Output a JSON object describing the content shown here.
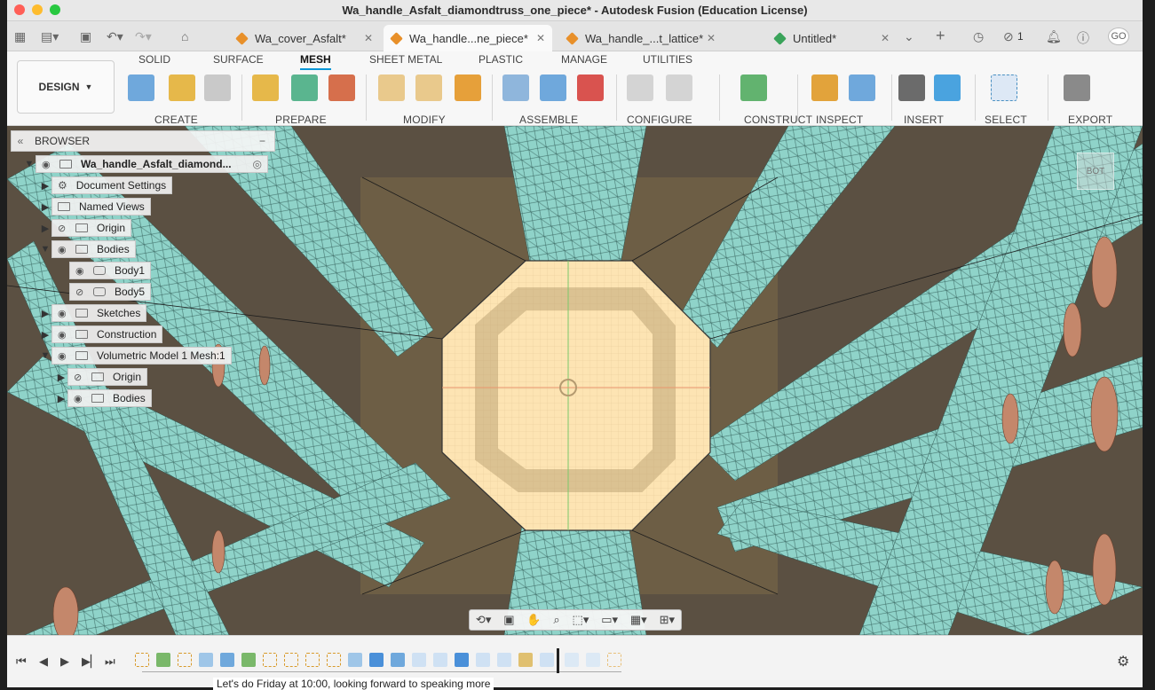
{
  "window": {
    "title": "Wa_handle_Asfalt_diamondtruss_one_piece* - Autodesk Fusion (Education License)"
  },
  "tabs": [
    {
      "label": "Wa_cover_Asfalt*"
    },
    {
      "label": "Wa_handle...ne_piece*"
    },
    {
      "label": "Wa_handle_...t_lattice*"
    },
    {
      "label": "Untitled*"
    }
  ],
  "tabbar": {
    "notification_count": "1",
    "user_initials": "GO"
  },
  "workspace": {
    "label": "DESIGN"
  },
  "toolbar_tabs": [
    {
      "label": "SOLID"
    },
    {
      "label": "SURFACE"
    },
    {
      "label": "MESH"
    },
    {
      "label": "SHEET METAL"
    },
    {
      "label": "PLASTIC"
    },
    {
      "label": "MANAGE"
    },
    {
      "label": "UTILITIES"
    }
  ],
  "tool_groups": [
    {
      "label": "CREATE"
    },
    {
      "label": "PREPARE"
    },
    {
      "label": "MODIFY"
    },
    {
      "label": "ASSEMBLE"
    },
    {
      "label": "CONFIGURE"
    },
    {
      "label": "CONSTRUCT"
    },
    {
      "label": "INSPECT"
    },
    {
      "label": "INSERT"
    },
    {
      "label": "SELECT"
    },
    {
      "label": "EXPORT"
    }
  ],
  "browser": {
    "title": "BROWSER",
    "root": "Wa_handle_Asfalt_diamond...",
    "items": [
      {
        "label": "Document Settings"
      },
      {
        "label": "Named Views"
      },
      {
        "label": "Origin"
      },
      {
        "label": "Bodies"
      },
      {
        "label": "Body1"
      },
      {
        "label": "Body5"
      },
      {
        "label": "Sketches"
      },
      {
        "label": "Construction"
      },
      {
        "label": "Volumetric Model 1 Mesh:1"
      },
      {
        "label": "Origin"
      },
      {
        "label": "Bodies"
      }
    ]
  },
  "viewcube": {
    "label": "BOT"
  },
  "background_message": "Let's do Friday at 10:00, looking forward to speaking more"
}
